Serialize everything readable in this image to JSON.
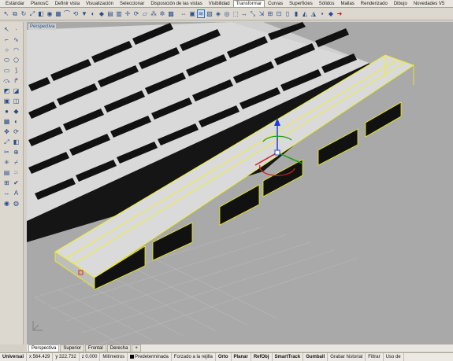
{
  "tabs": [
    "Estándar",
    "PlanosC",
    "Definir vista",
    "Visualización",
    "Seleccionar",
    "Disposición de las vistas",
    "Visibilidad",
    "Transformar",
    "Curvas",
    "Superficies",
    "Sólidos",
    "Mallas",
    "Renderizado",
    "Dibujo",
    "Novedades V5"
  ],
  "active_tab": "Transformar",
  "toolbar_icons": [
    "move-icon",
    "copy-icon",
    "rotate-icon",
    "scale-icon",
    "mirror-icon",
    "orient-icon",
    "array-icon",
    "bend-icon",
    "twist-icon",
    "taper-icon",
    "flow-icon",
    "smash-icon",
    "align-icon",
    "project-icon",
    "setpt-icon",
    "rotate3d-icon",
    "shear-icon",
    "array-curve-icon",
    "array-polar-icon",
    "array-surface-icon",
    "highlighted-tool-icon",
    "stretch-icon",
    "cage-icon",
    "flow-surface-icon",
    "splop-icon",
    "maelstrom-icon",
    "sporph-icon",
    "scale1d-icon",
    "scale2d-icon",
    "scalens-icon",
    "orient-surface-icon",
    "remap-icon",
    "arrange-icon",
    "unroll-icon",
    "squish-icon",
    "smash-surface-icon",
    "extra-a-icon",
    "extra-b-icon",
    "extra-c-icon"
  ],
  "highlighted_tool": "highlighted-tool-icon",
  "accent_color": "#e0201c",
  "viewport": {
    "label": "Perspectiva"
  },
  "viewport_tabs": [
    "Perspectiva",
    "Superior",
    "Frontal",
    "Derecha",
    "+"
  ],
  "active_viewport_tab": "Perspectiva",
  "status": {
    "cplane": "Universal",
    "x": "x 564.429",
    "y": "y 322.732",
    "z": "z 0.000",
    "units": "Milímetros",
    "layer": "Predeterminada",
    "snap": "Forzado a la rejilla",
    "orto": "Orto",
    "planar": "Planar",
    "refobj": "RefObj",
    "smarttrack": "SmartTrack",
    "gumball": "Gumball",
    "history": "Grabar historial",
    "filter": "Filtrar",
    "usage": "Uso de"
  }
}
